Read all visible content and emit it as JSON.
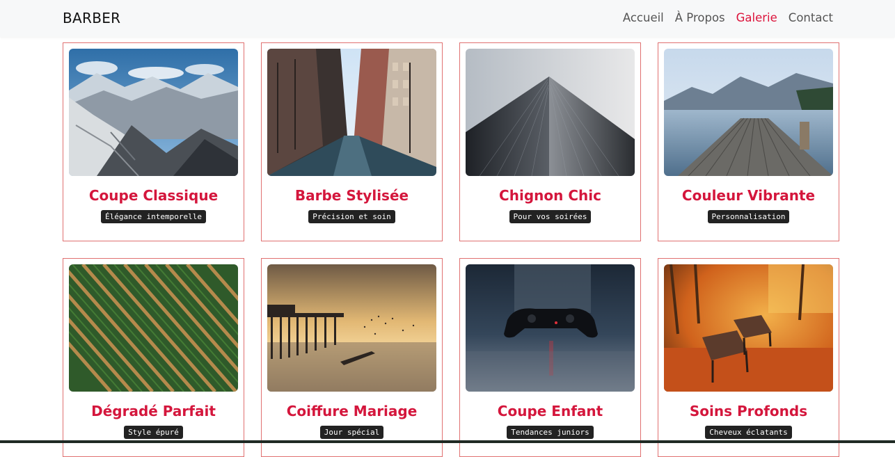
{
  "navbar": {
    "brand": "BARBER",
    "links": [
      {
        "label": "Accueil",
        "active": false
      },
      {
        "label": "À Propos",
        "active": false
      },
      {
        "label": "Galerie",
        "active": true
      },
      {
        "label": "Contact",
        "active": false
      }
    ]
  },
  "colors": {
    "accent": "#dc143c",
    "card_border": "#e07070",
    "tag_bg": "#222222"
  },
  "gallery": {
    "cards": [
      {
        "title": "Coupe Classique",
        "tag": "Élégance intemporelle",
        "image": "snowy-mountains-image"
      },
      {
        "title": "Barbe Stylisée",
        "tag": "Précision et soin",
        "image": "city-street-image"
      },
      {
        "title": "Chignon Chic",
        "tag": "Pour vos soirées",
        "image": "skyscraper-image"
      },
      {
        "title": "Couleur Vibrante",
        "tag": "Personnalisation",
        "image": "lake-pier-image"
      },
      {
        "title": "Dégradé Parfait",
        "tag": "Style épuré",
        "image": "crop-fields-image"
      },
      {
        "title": "Coiffure Mariage",
        "tag": "Jour spécial",
        "image": "sunset-pier-image"
      },
      {
        "title": "Coupe Enfant",
        "tag": "Tendances juniors",
        "image": "game-controller-image"
      },
      {
        "title": "Soins Profonds",
        "tag": "Cheveux éclatants",
        "image": "autumn-bench-image"
      }
    ]
  }
}
